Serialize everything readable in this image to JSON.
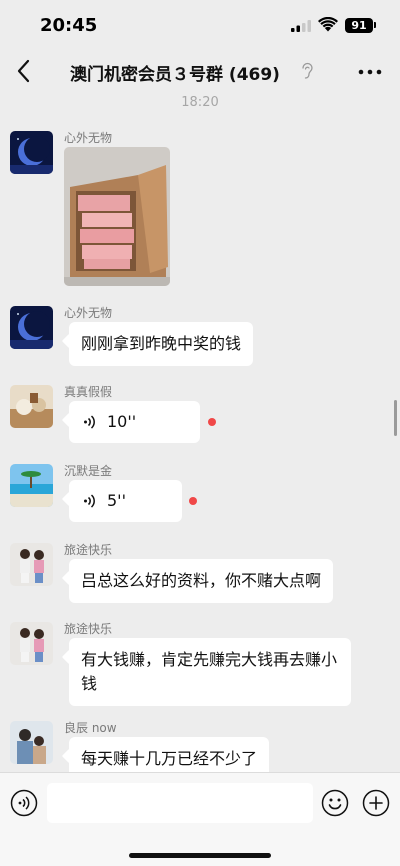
{
  "status": {
    "time": "20:45",
    "battery": "91"
  },
  "nav": {
    "title": "澳门机密会员３号群 (469)",
    "back_icon": "chevron-left-icon",
    "mute_icon": "ear-icon",
    "more_icon": "more-dots-icon"
  },
  "chat": {
    "timestamp": "18:20",
    "messages": [
      {
        "sender": "心外无物",
        "type": "image",
        "image_desc": "cardboard box of banknotes"
      },
      {
        "sender": "心外无物",
        "type": "text",
        "text": "刚刚拿到昨晚中奖的钱"
      },
      {
        "sender": "真真假假",
        "type": "voice",
        "duration": "10''",
        "unread": true
      },
      {
        "sender": "沉默是金",
        "type": "voice",
        "duration": "5''",
        "unread": true
      },
      {
        "sender": "旅途快乐",
        "type": "text",
        "text": "吕总这么好的资料，你不赌大点啊"
      },
      {
        "sender": "旅途快乐",
        "type": "text",
        "text": "有大钱赚，肯定先赚完大钱再去赚小钱"
      },
      {
        "sender": "良辰 now",
        "type": "text",
        "text": "每天赚十几万已经不少了"
      }
    ]
  },
  "input_bar": {
    "voice_icon": "voice-toggle-icon",
    "emoji_icon": "emoji-icon",
    "plus_icon": "plus-icon",
    "placeholder": ""
  },
  "colors": {
    "background": "#ededed",
    "bubble": "#ffffff",
    "unread_dot": "#f04848",
    "input_bar": "#f7f7f7"
  }
}
